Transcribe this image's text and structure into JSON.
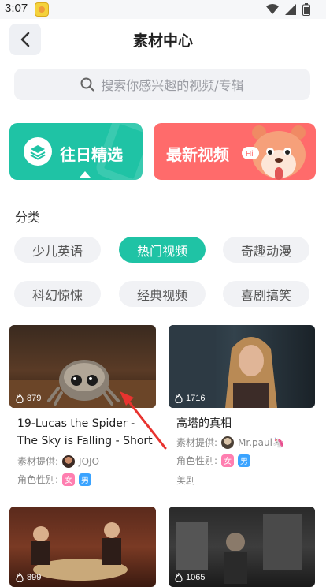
{
  "status": {
    "time": "3:07"
  },
  "header": {
    "title": "素材中心"
  },
  "search": {
    "placeholder": "搜索你感兴趣的视频/专辑"
  },
  "banners": {
    "past_label": "往日精选",
    "new_label": "最新视频",
    "mascot_badge": "Hi"
  },
  "category": {
    "section_label": "分类",
    "chips": [
      "少儿英语",
      "热门视频",
      "奇趣动漫",
      "科幻惊悚",
      "经典视频",
      "喜剧搞笑"
    ],
    "active_index": 1
  },
  "cards": [
    {
      "views": "879",
      "title_line1": "19-Lucas the Spider -",
      "title_line2": "The Sky is Falling - Short",
      "provider_label": "素材提供:",
      "provider_name": "JOJO",
      "gender_label": "角色性别:",
      "tag_f": "女",
      "tag_m": "男"
    },
    {
      "views": "1716",
      "title": "高塔的真相",
      "provider_label": "素材提供:",
      "provider_name": "Mr.paul🦄",
      "gender_label": "角色性别:",
      "tag_f": "女",
      "tag_m": "男",
      "genre": "美剧"
    },
    {
      "views": "899"
    },
    {
      "views": "1065"
    }
  ],
  "colors": {
    "accent": "#1fc3a5",
    "banner_red": "#ff6b6b",
    "female": "#ff7eb0",
    "male": "#3aa3ff"
  }
}
